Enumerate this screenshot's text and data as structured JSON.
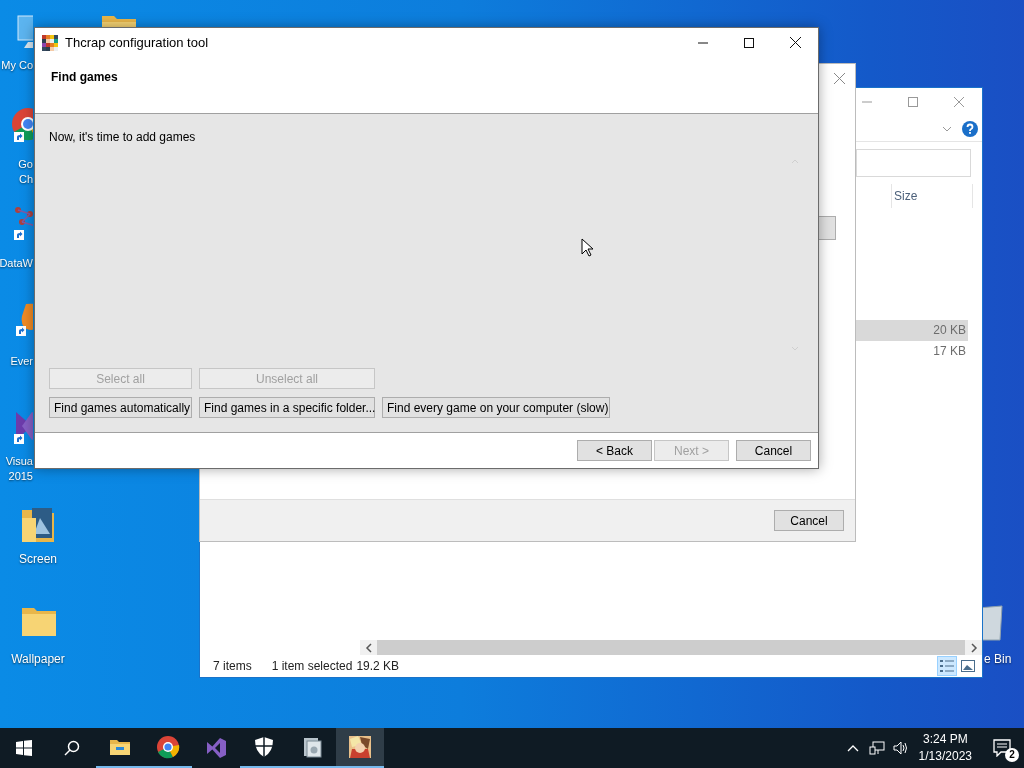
{
  "desktop": {
    "icons": [
      {
        "kind": "computer",
        "label": "My Co"
      },
      {
        "kind": "folder"
      },
      {
        "kind": "chrome",
        "label": "Go\nCh"
      },
      {
        "kind": "mesh",
        "label": "DataW"
      },
      {
        "kind": "note",
        "label": "Ever"
      },
      {
        "kind": "studio",
        "label": "Visua\n2015"
      },
      {
        "kind": "picture-folder",
        "label": "Screen"
      },
      {
        "kind": "folder",
        "label": "Wallpaper"
      },
      {
        "kind": "bin",
        "label": "e Bin"
      }
    ]
  },
  "explorer": {
    "column_header": "Size",
    "rows": [
      {
        "size": "20 KB",
        "selected": true
      },
      {
        "size": "17 KB",
        "selected": false
      }
    ],
    "views": [
      {
        "kind": "details",
        "selected": true
      },
      {
        "kind": "tiles",
        "selected": false
      }
    ],
    "status": {
      "item_count": "7 items",
      "selection": "1 item selected",
      "selection_size": "19.2 KB"
    }
  },
  "file_dialog": {
    "cancel_button": "Cancel"
  },
  "window": {
    "title": "Thcrap configuration tool",
    "header": "Find games",
    "intro": "Now, it's time to add games",
    "selection_buttons": [
      {
        "label": "Select all",
        "disabled": true
      },
      {
        "label": "Unselect all",
        "disabled": true
      }
    ],
    "search_buttons": [
      {
        "label": "Find games automatically",
        "disabled": false
      },
      {
        "label": "Find games in a specific folder...",
        "disabled": false
      },
      {
        "label": "Find every game on your computer (slow)",
        "disabled": false
      }
    ],
    "nav_buttons": [
      {
        "label": "< Back",
        "disabled": false
      },
      {
        "label": "Next >",
        "disabled": true
      },
      {
        "label": "Cancel",
        "disabled": false
      }
    ]
  },
  "taskbar": {
    "apps": [
      {
        "kind": "explorer",
        "running": true,
        "selected": false
      },
      {
        "kind": "chrome",
        "running": true,
        "selected": false
      },
      {
        "kind": "studio",
        "running": false,
        "selected": false
      },
      {
        "kind": "shield",
        "running": true,
        "selected": false
      },
      {
        "kind": "installer",
        "running": true,
        "selected": false
      },
      {
        "kind": "thcrap",
        "running": true,
        "selected": true
      }
    ],
    "time": "3:24 PM",
    "date": "1/13/2023",
    "notification_count": "2"
  }
}
